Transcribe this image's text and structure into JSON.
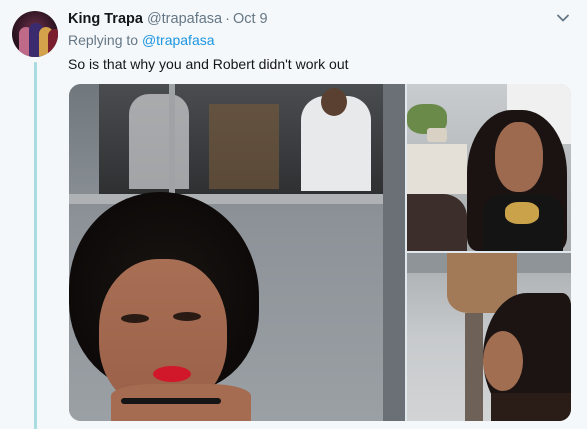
{
  "tweet": {
    "author": {
      "display_name": "King Trapa",
      "handle": "@trapafasa",
      "avatar_icon": "user-avatar"
    },
    "separator": "·",
    "timestamp": "Oct 9",
    "replying_to": {
      "prefix": "Replying to",
      "mention": "@trapafasa"
    },
    "text": "So is that why you and Robert didn't work out",
    "menu_icon": "chevron-down-icon",
    "media": [
      {
        "name": "woman-red-lips-photo"
      },
      {
        "name": "woman-gold-necklace-photo"
      },
      {
        "name": "woman-profile-photo"
      }
    ]
  },
  "colors": {
    "background": "#f5f8fa",
    "thread_line": "#a8dce0",
    "link": "#1b95e0",
    "secondary_text": "#657786",
    "primary_text": "#14171a"
  }
}
